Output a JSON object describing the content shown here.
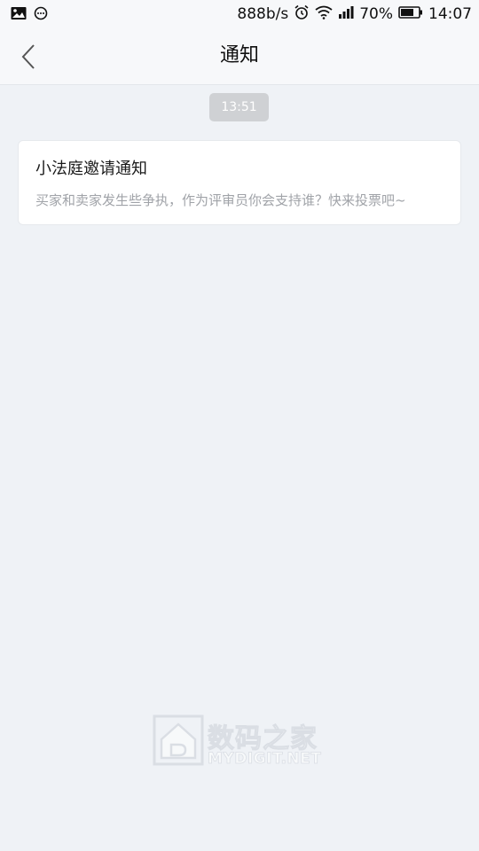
{
  "status_bar": {
    "network_speed": "888b/s",
    "battery": "70%",
    "time": "14:07",
    "icons": [
      "image-icon",
      "chat-bubble-icon",
      "alarm-icon",
      "wifi-icon",
      "signal-icon",
      "battery-icon"
    ]
  },
  "header": {
    "title": "通知",
    "back_icon": "chevron-left-icon"
  },
  "messages": {
    "timestamp": "13:51",
    "notice": {
      "title": "小法庭邀请通知",
      "description": "买家和卖家发生些争执，作为评审员你会支持谁？快来投票吧~"
    }
  },
  "watermark": {
    "brand_cn": "数码之家",
    "brand_en": "MYDIGIT.NET"
  },
  "colors": {
    "background": "#eff2f6",
    "header_bg": "#f7f8fa",
    "card_bg": "#ffffff",
    "muted_text": "#a0a3a8",
    "time_pill": "#cfd1d4"
  }
}
